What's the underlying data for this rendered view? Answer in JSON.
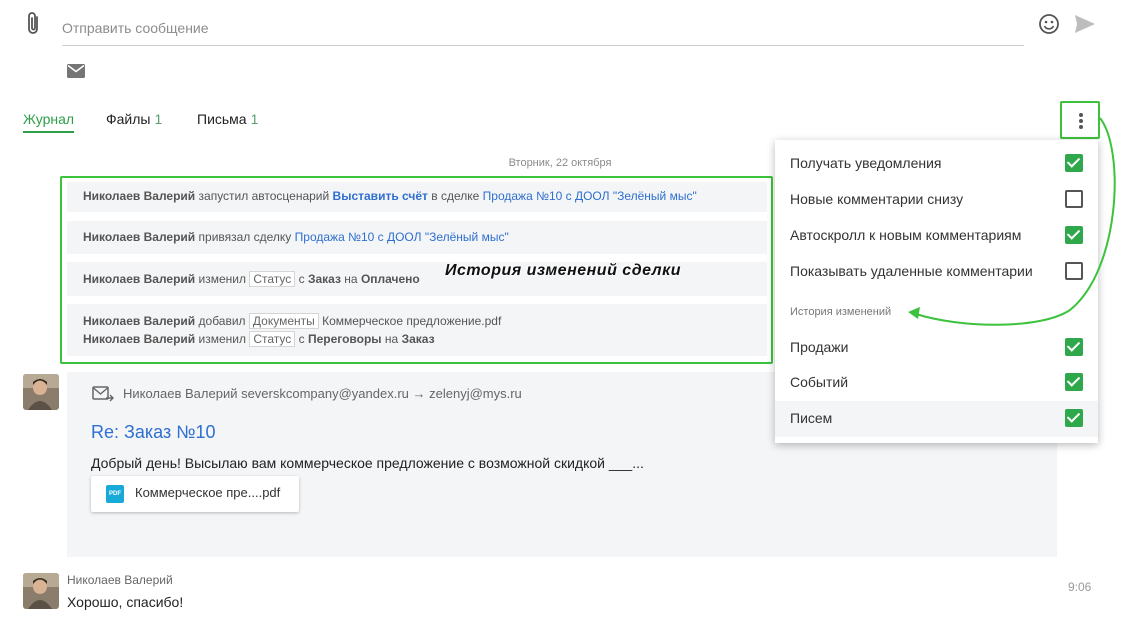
{
  "composer": {
    "placeholder": "Отправить сообщение"
  },
  "tabs": [
    {
      "label": "Журнал",
      "count": ""
    },
    {
      "label": "Файлы",
      "count": "1"
    },
    {
      "label": "Письма",
      "count": "1"
    }
  ],
  "date_separator": "Вторник, 22 октября",
  "journal": {
    "row1": {
      "who": "Николаев Валерий",
      "t1": "запустил автосценарий",
      "link1": "Выставить счёт",
      "t2": "в сделке",
      "link2": "Продажа №10 с ДООЛ \"Зелёный мыс\""
    },
    "row2": {
      "who": "Николаев Валерий",
      "t1": "привязал сделку",
      "link1": "Продажа №10 с ДООЛ \"Зелёный мыс\""
    },
    "row3": {
      "who": "Николаев Валерий",
      "t1": "изменил",
      "tag": "Статус",
      "t2": "с",
      "from": "Заказ",
      "t3": "на",
      "to": "Оплачено"
    },
    "row4a": {
      "who": "Николаев Валерий",
      "t1": "добавил",
      "tag": "Документы",
      "t2": "Коммерческое предложение.pdf"
    },
    "row4b": {
      "who": "Николаев Валерий",
      "t1": "изменил",
      "tag": "Статус",
      "t2": "с",
      "from": "Переговоры",
      "t3": "на",
      "to": "Заказ"
    }
  },
  "annotation": "История изменений сделки",
  "email": {
    "meta": "Николаев Валерий severskcompany@yandex.ru → zelenyj@mys.ru",
    "subject": "Re: Заказ №10",
    "body": "Добрый день! Высылаю вам коммерческое предложение с возможной скидкой ___...",
    "attachment": "Коммерческое пре....pdf",
    "attachment_type": "PDF"
  },
  "comment": {
    "author": "Николаев Валерий",
    "text": "Хорошо, спасибо!",
    "time": "9:06"
  },
  "menu": {
    "items": [
      {
        "label": "Получать уведомления",
        "checked": true
      },
      {
        "label": "Новые комментарии снизу",
        "checked": false
      },
      {
        "label": "Автоскролл к новым комментариям",
        "checked": true
      },
      {
        "label": "Показывать удаленные комментарии",
        "checked": false
      }
    ],
    "section_title": "История изменений",
    "history_items": [
      {
        "label": "Продажи",
        "checked": true
      },
      {
        "label": "Событий",
        "checked": true
      },
      {
        "label": "Писем",
        "checked": true
      }
    ]
  },
  "colors": {
    "accent": "#2e9e4a",
    "link": "#2f6fd0",
    "highlight": "#3cc23c"
  }
}
